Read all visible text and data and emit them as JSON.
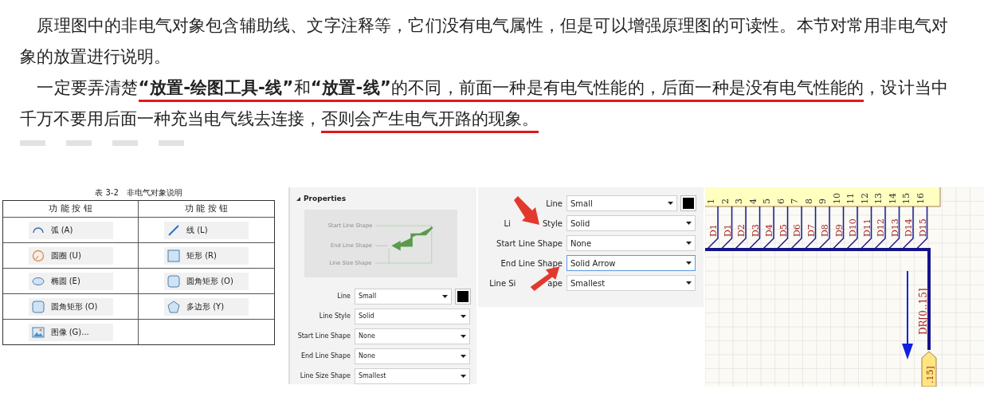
{
  "intro": {
    "paragraphs": [
      [
        {
          "text": "原理图中的非电气对象包含辅助线、文字注释等，它们没有电气属性，但是可以增强原理图的可读性。本节对常用非电气对象的放置进行说明。",
          "underlined": false
        }
      ],
      [
        {
          "text": "一定要弄清楚",
          "underlined": false
        },
        {
          "text": "**“放置-绘图工具-线”**和**“放置-线”**的不同，前面一种是有电气性能的，后面一种是没有电气性能的",
          "underlined": true
        },
        {
          "text": "，设计当中千万不要用后面一种充当电气线去连接，",
          "underlined": false
        },
        {
          "text": "否则会产生电气开路的现象。",
          "underlined": true
        }
      ]
    ]
  },
  "table": {
    "caption": "表 3-2　非电气对象说明",
    "columns": [
      "功 能 按 钮",
      "功 能 按 钮"
    ],
    "rows": [
      [
        {
          "kind": "arc",
          "label": "弧 (A)"
        },
        {
          "kind": "line",
          "label": "线 (L)"
        }
      ],
      [
        {
          "kind": "circle",
          "label": "圆圈 (U)"
        },
        {
          "kind": "rect",
          "label": "矩形 (R)"
        }
      ],
      [
        {
          "kind": "ellipse",
          "label": "椭圆 (E)"
        },
        {
          "kind": "roundrect",
          "label": "圆角矩形 (O)"
        }
      ],
      [
        {
          "kind": "roundrect",
          "label": "圆角矩形 (O)"
        },
        {
          "kind": "polygon",
          "label": "多边形 (Y)"
        }
      ],
      [
        {
          "kind": "image",
          "label": "图像 (G)..."
        }
      ]
    ]
  },
  "panels": [
    {
      "title": "Properties",
      "preview": [
        "Start Line Shape",
        "End Line Shape",
        "Line Size Shape"
      ],
      "fields": [
        {
          "label": "Line",
          "value": "Small",
          "kind": "select-color",
          "focused": false
        },
        {
          "label": "Line Style",
          "value": "Solid",
          "kind": "select",
          "focused": false
        },
        {
          "label": "Start Line Shape",
          "value": "None",
          "kind": "select",
          "focused": false
        },
        {
          "label": "End Line Shape",
          "value": "None",
          "kind": "select",
          "focused": false
        },
        {
          "label": "Line Size Shape",
          "value": "Smallest",
          "kind": "select",
          "focused": false
        }
      ]
    },
    {
      "fields": [
        {
          "label": "Line",
          "value": "Small",
          "kind": "select-color",
          "focused": false
        },
        {
          "label": [
            "Li",
            "Style"
          ],
          "value": "Solid",
          "kind": "select",
          "focused": false
        },
        {
          "label": "Start Line Shape",
          "value": "None",
          "kind": "select",
          "focused": false
        },
        {
          "label": "End Line Shape",
          "value": "Solid Arrow",
          "kind": "select",
          "focused": true
        },
        {
          "label": [
            "Line Si",
            "ape"
          ],
          "value": "Smallest",
          "kind": "select",
          "focused": false
        }
      ]
    }
  ],
  "schematic": {
    "pins": [
      {
        "number": "1",
        "net": "D1"
      },
      {
        "number": "2",
        "net": "D1"
      },
      {
        "number": "3",
        "net": "D2"
      },
      {
        "number": "4",
        "net": "D3"
      },
      {
        "number": "5",
        "net": "D4"
      },
      {
        "number": "6",
        "net": "D5"
      },
      {
        "number": "7",
        "net": "D6"
      },
      {
        "number": "8",
        "net": "D7"
      },
      {
        "number": "9",
        "net": "D8"
      },
      {
        "number": "10",
        "net": "D9"
      },
      {
        "number": "11",
        "net": "D10"
      },
      {
        "number": "12",
        "net": "D11"
      },
      {
        "number": "13",
        "net": "D12"
      },
      {
        "number": "14",
        "net": "D13"
      },
      {
        "number": "15",
        "net": "D14"
      },
      {
        "number": "16",
        "net": "D15"
      }
    ],
    "bus_label": "DR[0..15]",
    "port": ".15]"
  }
}
